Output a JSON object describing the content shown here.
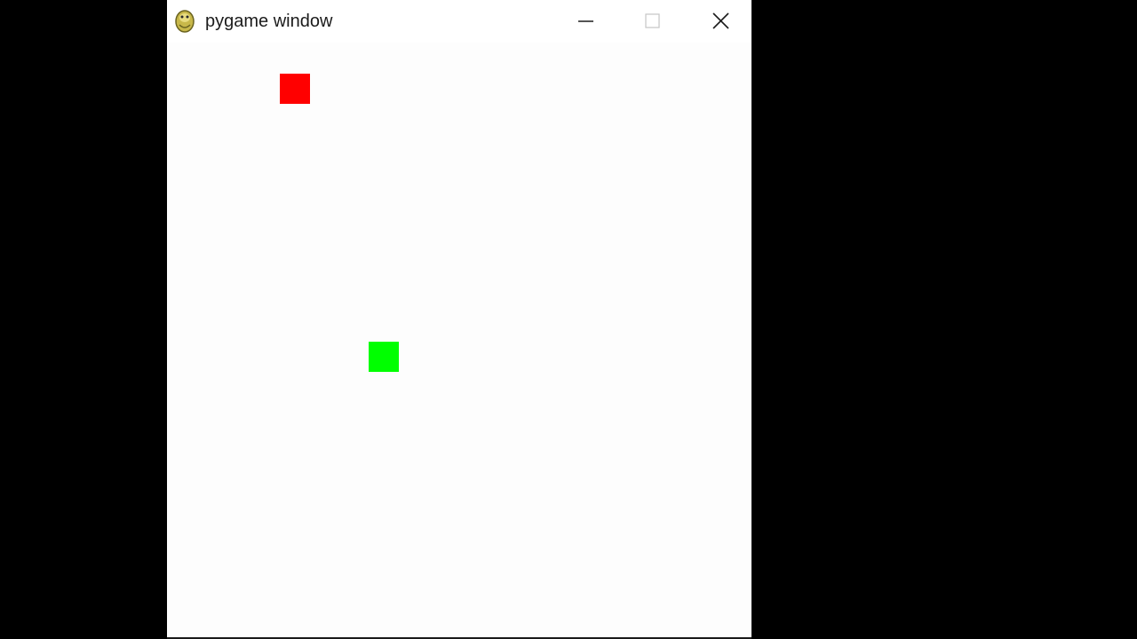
{
  "window": {
    "title": "pygame window",
    "icon": "pygame-snake-icon"
  },
  "controls": {
    "minimize_icon": "minimize-icon",
    "maximize_icon": "maximize-icon",
    "close_icon": "close-icon"
  },
  "game": {
    "sprites": [
      {
        "name": "red-square",
        "color": "#ff0000"
      },
      {
        "name": "green-square",
        "color": "#00ff00"
      }
    ],
    "background_color": "#fdfdfd"
  }
}
